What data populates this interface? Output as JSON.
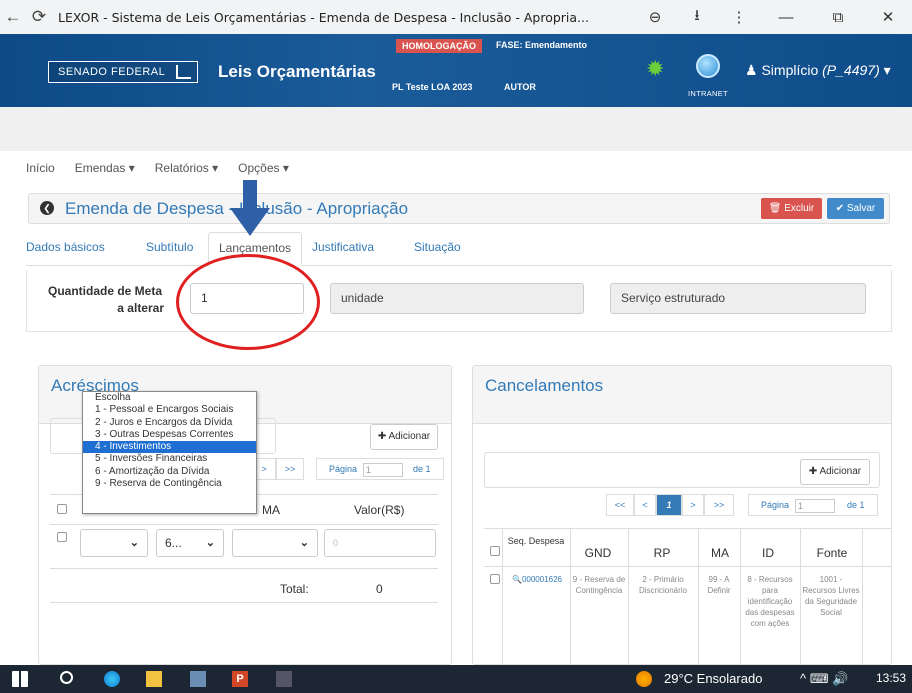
{
  "browser": {
    "title": "LEXOR - Sistema de Leis Orçamentárias - Emenda de Despesa - Inclusão - Apropria...",
    "back_icon": "←",
    "reload_icon": "⟳",
    "zoom_icon": "⊖",
    "download_icon": "⭳",
    "more_icon": "⋮",
    "minimize_icon": "—",
    "restore_icon": "⧉",
    "close_icon": "✕"
  },
  "header": {
    "org": "SENADO FEDERAL",
    "app_name": "Leis Orçamentárias",
    "env_badge": "HOMOLOGAÇÃO",
    "phase": "FASE: Emendamento",
    "pl": "PL Teste LOA 2023",
    "role": "AUTOR",
    "intranet": "INTRANET",
    "user_prefix": "Simplício",
    "user_id": "(P_4497)",
    "user_caret": "▾"
  },
  "menu": {
    "items": [
      "Início",
      "Emendas ▾",
      "Relatórios ▾",
      "Opções ▾"
    ]
  },
  "page": {
    "back_icon": "❮",
    "title": "Emenda de Despesa - Inclusão - Apropriação",
    "delete_label": "🗑 Excluir",
    "save_label": "✔ Salvar"
  },
  "tabs": [
    "Dados básicos",
    "Subtítulo",
    "Lançamentos",
    "Justificativa",
    "Situação"
  ],
  "meta": {
    "label_line1": "Quantidade de Meta",
    "label_line2": "a alterar",
    "value": "1",
    "unit": "unidade",
    "product": "Serviço estruturado"
  },
  "acrescimos": {
    "title": "Acréscimos",
    "add_label": "✚ Adicionar",
    "next": ">",
    "last": ">>",
    "page_label": "Página",
    "page_value": "1",
    "page_of": "de 1",
    "col_ma": "MA",
    "col_valor": "Valor(R$)",
    "row_gnd_value": "",
    "row_rp_value": "6...",
    "row_valor_placeholder": "0",
    "total_label": "Total:",
    "total_value": "0",
    "gnd_options": [
      "Escolha",
      "1 - Pessoal e Encargos Sociais",
      "2 - Juros e Encargos da Dívida",
      "3 - Outras Despesas Correntes",
      "4 - Investimentos",
      "5 - Inversões Financeiras",
      "6 - Amortização da Dívida",
      "9 - Reserva de Contingência"
    ],
    "selected_option": "4 - Investimentos"
  },
  "cancelamentos": {
    "title": "Cancelamentos",
    "add_label": "✚ Adicionar",
    "first": "<<",
    "prev": "<",
    "current": "1",
    "next": ">",
    "last": ">>",
    "page_label": "Página",
    "page_value": "1",
    "page_of": "de 1",
    "columns": [
      "Seq. Despesa",
      "GND",
      "RP",
      "MA",
      "ID",
      "Fonte"
    ],
    "row": {
      "seq": "000001626",
      "gnd": "9 - Reserva de Contingência",
      "rp": "2 - Primário Discricionário",
      "ma": "99 - A Definir",
      "id": "8 - Recursos para identificação das despesas com ações",
      "fonte": "1001 - Recursos Livres da Seguridade Social"
    }
  },
  "taskbar": {
    "weather": "29°C  Ensolarado",
    "tray": "^  ⌨  🔊",
    "time": "13:53"
  }
}
